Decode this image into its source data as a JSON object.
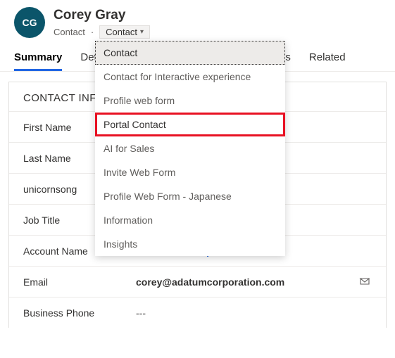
{
  "header": {
    "initials": "CG",
    "name": "Corey Gray",
    "entity": "Contact",
    "separator": "·",
    "formLabel": "Contact"
  },
  "tabs": {
    "summary": "Summary",
    "details_partial": "Det",
    "files_partial": "les",
    "related": "Related"
  },
  "section": {
    "title": "CONTACT INFORMATION"
  },
  "fields": {
    "firstName": {
      "label": "First Name",
      "value": ""
    },
    "lastName": {
      "label": "Last Name",
      "value": ""
    },
    "username": {
      "label": "unicornsong",
      "value": ""
    },
    "jobTitle": {
      "label": "Job Title",
      "value": ""
    },
    "accountName": {
      "label": "Account Name",
      "value": "Adatum Corporation"
    },
    "email": {
      "label": "Email",
      "value": "corey@adatumcorporation.com"
    },
    "businessPhone": {
      "label": "Business Phone",
      "value": "---"
    }
  },
  "dropdown": {
    "items": [
      "Contact",
      "Contact for Interactive experience",
      "Profile web form",
      "Portal Contact",
      "AI for Sales",
      "Invite Web Form",
      "Profile Web Form - Japanese",
      "Information",
      "Insights"
    ]
  }
}
